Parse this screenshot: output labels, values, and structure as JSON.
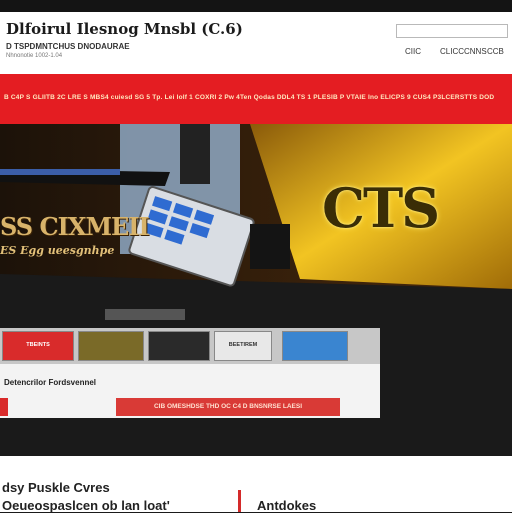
{
  "header": {
    "title": "Dlfoirul Ilesnog Mnsbl (C.6)",
    "subtitle": "D TSPDMNTCHUS DNODAURAE",
    "meta": "Nhnonotie 1002-1.04",
    "search_placeholder": "",
    "nav": [
      "CIIC",
      "CLICCCNNS",
      "CCB"
    ]
  },
  "promo_band": {
    "text": "B C4P S GLIITB 2C LRE S MBS4 cuiesd SG 5 Tp. Lei lolf 1 COXRI 2 Pw 4Ten Qodas DDL4 TS 1 PLESIB P VTAIE Ino ELICPS 9 CUS4 P3LCERSTTS DOD"
  },
  "hero": {
    "title": "SS CIXMEII",
    "tagline": "ES Egg ueesgnhpe",
    "logo_text": "CTS"
  },
  "gallery": {
    "thumbs": [
      {
        "label": "TBEINTS",
        "color": "#d92b2b"
      },
      {
        "label": "",
        "color": "#7a6a28"
      },
      {
        "label": "",
        "color": "#2a2a2a"
      },
      {
        "label": "BEETIREM",
        "color": "#e8e8e8"
      },
      {
        "label": "",
        "color": "#3a85d0"
      }
    ],
    "caption": "Detencrilor Fordsvennel",
    "banner": "CIB OMESHDSE THD OC C4 D BNSNRSE LAESI"
  },
  "bottom": {
    "heading1": "dsy Puskle Cvres",
    "heading2": "Oeueospaslcen ob lan loat'",
    "right_heading": "Antdokes"
  }
}
